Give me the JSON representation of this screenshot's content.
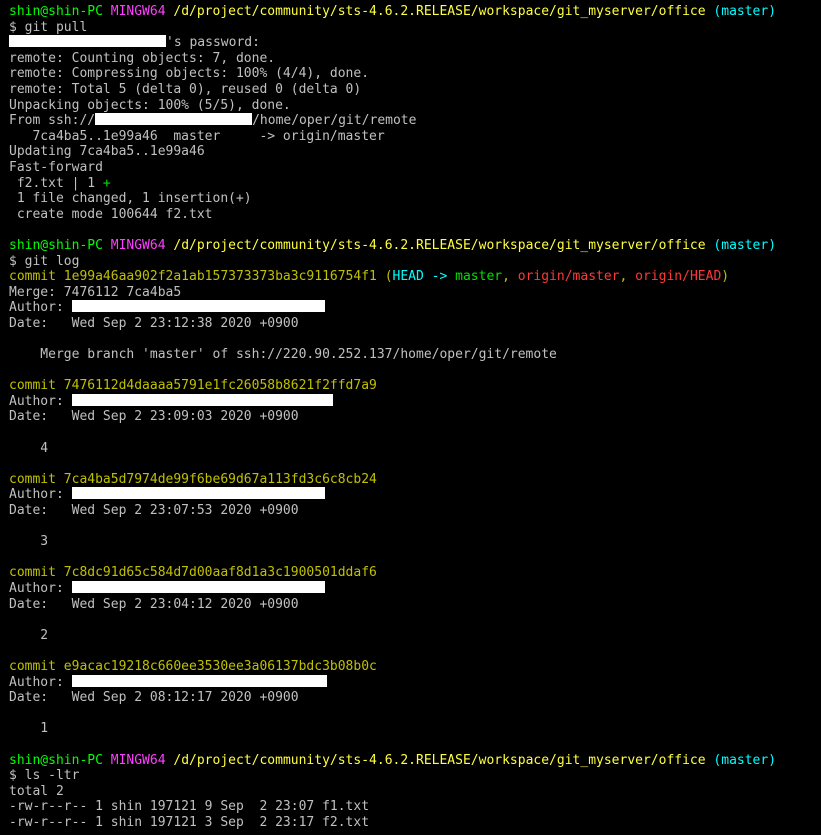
{
  "prompt": {
    "user_host": "shin@shin-PC",
    "shell": "MINGW64",
    "path": "/d/project/community/sts-4.6.2.RELEASE/workspace/git_myserver/office",
    "branch": "(master)"
  },
  "sections": {
    "pull": {
      "cmd": "$ git pull",
      "password_suffix": "'s password:",
      "lines": [
        "remote: Counting objects: 7, done.",
        "remote: Compressing objects: 100% (4/4), done.",
        "remote: Total 5 (delta 0), reused 0 (delta 0)",
        "Unpacking objects: 100% (5/5), done."
      ],
      "from_prefix": "From ssh://",
      "from_suffix": "/home/oper/git/remote",
      "ref_line": "   7ca4ba5..1e99a46  master     -> origin/master",
      "updating": "Updating 7ca4ba5..1e99a46",
      "fast_forward": "Fast-forward",
      "stat_file": " f2.txt | 1 ",
      "stat_plus": "+",
      "summary": " 1 file changed, 1 insertion(+)",
      "create_mode": " create mode 100644 f2.txt"
    },
    "log": {
      "cmd": "$ git log",
      "head_commit": {
        "prefix": "commit 1e99a46aa902f2a1ab157373373ba3c9116754f1 ",
        "paren_open": "(",
        "head": "HEAD -> ",
        "master": "master",
        "comma1": ", ",
        "origin_master": "origin/master",
        "comma2": ", ",
        "origin": "origin/",
        "origin_head": "HEAD",
        "paren_close": ")",
        "merge": "Merge: 7476112 7ca4ba5",
        "author": "Author: ",
        "date": "Date:   Wed Sep 2 23:12:38 2020 +0900",
        "message": "    Merge branch 'master' of ssh://220.90.252.137/home/oper/git/remote"
      },
      "commits": [
        {
          "hash": "commit 7476112d4daaaa5791e1fc26058b8621f2ffd7a9",
          "author": "Author: ",
          "date": "Date:   Wed Sep 2 23:09:03 2020 +0900",
          "message": "    4"
        },
        {
          "hash": "commit 7ca4ba5d7974de99f6be69d67a113fd3c6c8cb24",
          "author": "Author: ",
          "date": "Date:   Wed Sep 2 23:07:53 2020 +0900",
          "message": "    3"
        },
        {
          "hash": "commit 7c8dc91d65c584d7d00aaf8d1a3c1900501ddaf6",
          "author": "Author: ",
          "date": "Date:   Wed Sep 2 23:04:12 2020 +0900",
          "message": "    2"
        },
        {
          "hash": "commit e9acac19218c660ee3530ee3a06137bdc3b08b0c",
          "author": "Author: ",
          "date": "Date:   Wed Sep 2 08:12:17 2020 +0900",
          "message": "    1"
        }
      ]
    },
    "ls": {
      "cmd": "$ ls -ltr",
      "total": "total 2",
      "files": [
        "-rw-r--r-- 1 shin 197121 9 Sep  2 23:07 f1.txt",
        "-rw-r--r-- 1 shin 197121 3 Sep  2 23:17 f2.txt"
      ]
    }
  },
  "colors": {
    "background": "#000000",
    "prompt_user": "#00ff00",
    "prompt_shell": "#ff40ff",
    "prompt_path": "#ffff40",
    "prompt_branch": "#00ffff",
    "commit_hash": "#c0c000",
    "ref_head": "#00ffff",
    "ref_branch": "#00e000",
    "ref_remote": "#ff3838"
  }
}
